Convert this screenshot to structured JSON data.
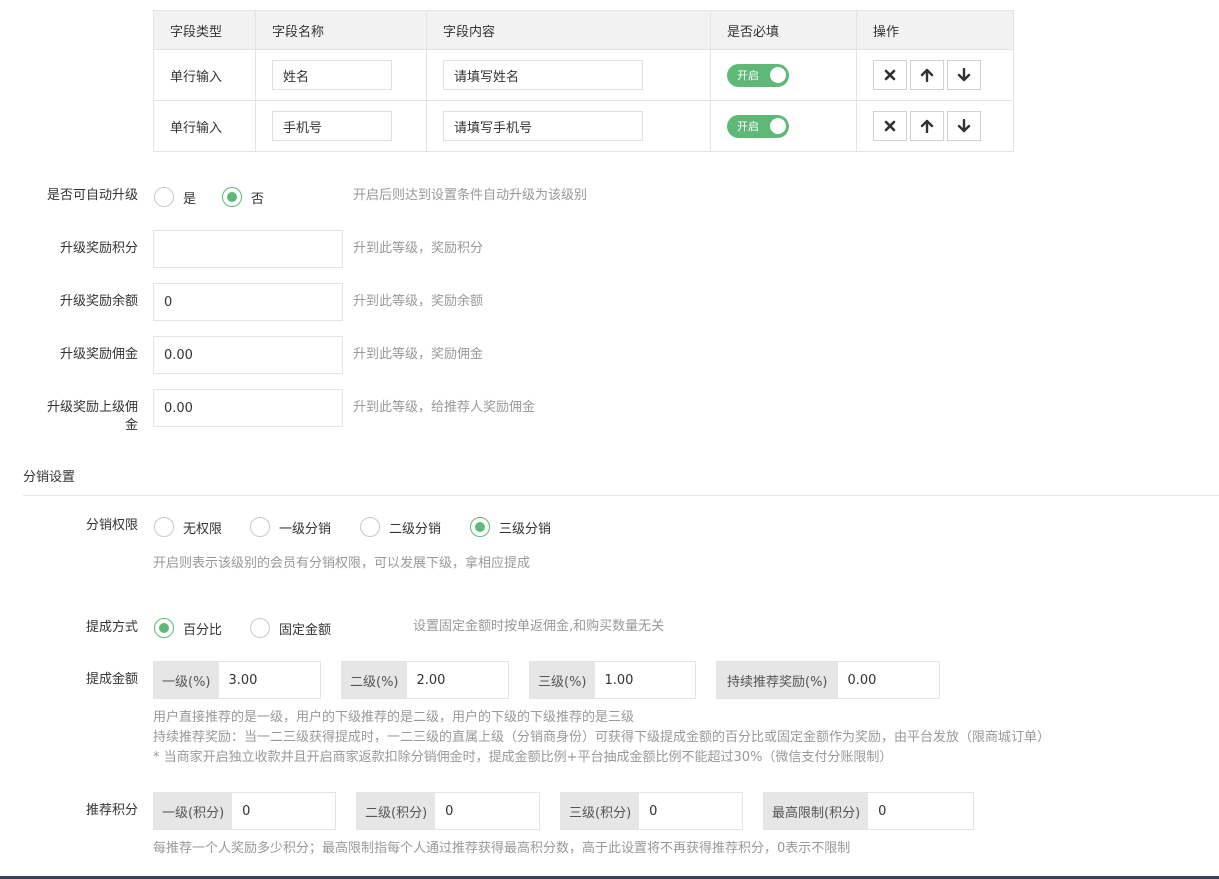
{
  "custom_fields": {
    "headers": [
      "字段类型",
      "字段名称",
      "字段内容",
      "是否必填",
      "操作"
    ],
    "rows": [
      {
        "type": "单行输入",
        "name": "姓名",
        "content": "请填写姓名",
        "required_label": "开启"
      },
      {
        "type": "单行输入",
        "name": "手机号",
        "content": "请填写手机号",
        "required_label": "开启"
      }
    ]
  },
  "auto_upgrade": {
    "label": "是否可自动升级",
    "options": [
      "是",
      "否"
    ],
    "selected": "否",
    "hint": "开启后则达到设置条件自动升级为该级别"
  },
  "reward_points": {
    "label": "升级奖励积分",
    "value": "",
    "hint": "升到此等级，奖励积分"
  },
  "reward_balance": {
    "label": "升级奖励余额",
    "value": "0",
    "hint": "升到此等级，奖励余额"
  },
  "reward_commission": {
    "label": "升级奖励佣金",
    "value": "0.00",
    "hint": "升到此等级，奖励佣金"
  },
  "reward_parent_commission": {
    "label_line1": "升级奖励上级佣",
    "label_line2": "金",
    "value": "0.00",
    "hint": "升到此等级，给推荐人奖励佣金"
  },
  "distribution": {
    "section_title": "分销设置",
    "permission": {
      "label": "分销权限",
      "options": [
        "无权限",
        "一级分销",
        "二级分销",
        "三级分销"
      ],
      "selected": "三级分销",
      "hint": "开启则表示该级别的会员有分销权限，可以发展下级，拿相应提成"
    },
    "commission_mode": {
      "label": "提成方式",
      "options": [
        "百分比",
        "固定金额"
      ],
      "selected": "百分比",
      "hint": "设置固定金额时按单返佣金,和购买数量无关"
    },
    "commission_amount": {
      "label": "提成金额",
      "level1": {
        "prefix": "一级(%)",
        "value": "3.00"
      },
      "level2": {
        "prefix": "二级(%)",
        "value": "2.00"
      },
      "level3": {
        "prefix": "三级(%)",
        "value": "1.00"
      },
      "continuous": {
        "prefix": "持续推荐奖励(%)",
        "value": "0.00"
      },
      "notes": [
        "用户直接推荐的是一级，用户的下级推荐的是二级，用户的下级的下级推荐的是三级",
        "持续推荐奖励：当一二三级获得提成时，一二三级的直属上级（分销商身份）可获得下级提成金额的百分比或固定金额作为奖励，由平台发放（限商城订单）",
        "* 当商家开启独立收款并且开启商家返款扣除分销佣金时，提成金额比例+平台抽成金额比例不能超过30%（微信支付分账限制）"
      ]
    },
    "referral_points": {
      "label": "推荐积分",
      "level1": {
        "prefix": "一级(积分)",
        "value": "0"
      },
      "level2": {
        "prefix": "二级(积分)",
        "value": "0"
      },
      "level3": {
        "prefix": "三级(积分)",
        "value": "0"
      },
      "max": {
        "prefix": "最高限制(积分)",
        "value": "0"
      },
      "hint": "每推荐一个人奖励多少积分；最高限制指每个人通过推荐获得最高积分数，高于此设置将不再获得推荐积分，0表示不限制"
    }
  },
  "colors": {
    "accent": "#5fb878",
    "hint_text": "#999999",
    "prefix_bg": "#e6e6e6"
  }
}
